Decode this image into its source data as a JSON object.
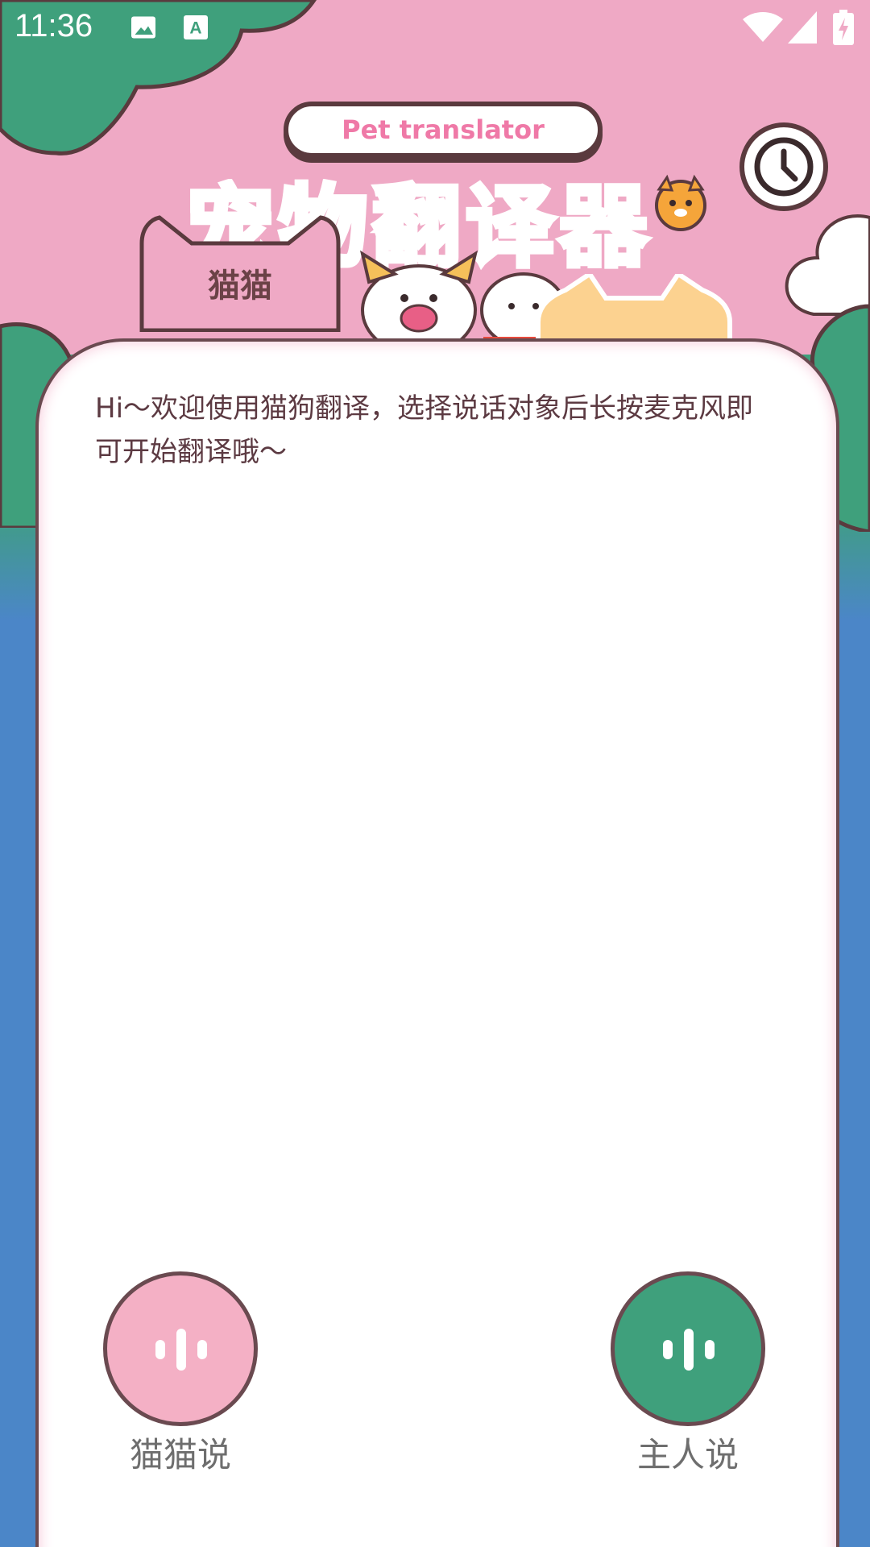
{
  "status_bar": {
    "time": "11:36",
    "icons": [
      "image-icon",
      "text-a-icon",
      "wifi-icon",
      "signal-icon",
      "battery-charging-icon"
    ]
  },
  "header": {
    "badge_text": "Pet translator",
    "title": "宠物翻译器",
    "history_icon": "clock-icon"
  },
  "tabs": {
    "active": "猫猫"
  },
  "chat": {
    "greeting": "Hi～欢迎使用猫狗翻译，选择说话对象后长按麦克风即可开始翻译哦～"
  },
  "buttons": {
    "cat_speak": {
      "label": "猫猫说",
      "icon": "sound-wave-icon",
      "color": "#f4b0c5"
    },
    "owner_speak": {
      "label": "主人说",
      "icon": "sound-wave-icon",
      "color": "#3fa07c"
    }
  },
  "colors": {
    "pink_bg": "#efa9c5",
    "green": "#3fa07c",
    "blue": "#4b86c8",
    "outline": "#5a3a3e",
    "title_pink": "#f46fa1"
  }
}
